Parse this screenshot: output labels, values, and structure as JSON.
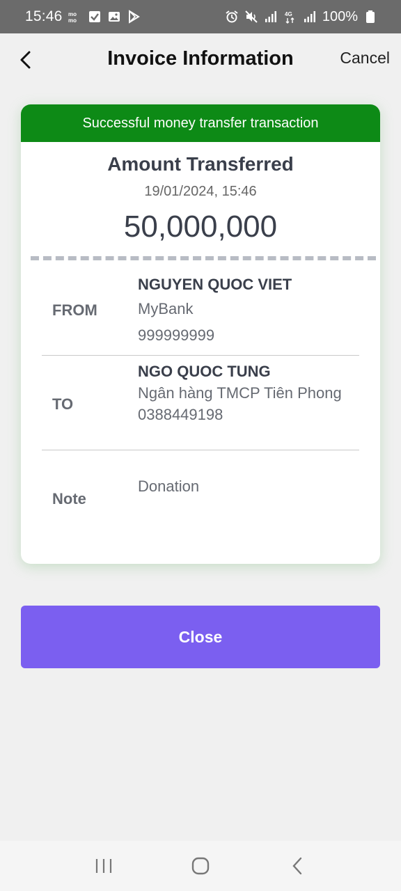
{
  "status_bar": {
    "time": "15:46",
    "battery": "100%",
    "left_icons": [
      "momo-icon",
      "checkbox-icon",
      "gallery-icon",
      "play-store-icon"
    ],
    "right_icons": [
      "alarm-icon",
      "mute-icon",
      "signal-icon",
      "4g-icon",
      "signal-icon",
      "battery-icon"
    ]
  },
  "header": {
    "title": "Invoice Information",
    "cancel_label": "Cancel"
  },
  "card": {
    "banner": "Successful money transfer transaction",
    "banner_color": "#0d8a16",
    "amount_title": "Amount Transferred",
    "datetime": "19/01/2024, 15:46",
    "amount": "50,000,000",
    "from": {
      "label": "FROM",
      "name": "NGUYEN QUOC VIET",
      "bank": "MyBank",
      "account": "999999999"
    },
    "to": {
      "label": "TO",
      "name": "NGO QUOC TUNG",
      "bank": "Ngân hàng TMCP Tiên Phong",
      "account": "0388449198"
    },
    "note": {
      "label": "Note",
      "value": "Donation"
    }
  },
  "close_button": {
    "label": "Close",
    "color": "#7b5ff0"
  },
  "nav_bar": {
    "buttons": [
      "recent-apps-icon",
      "home-icon",
      "back-icon"
    ]
  }
}
